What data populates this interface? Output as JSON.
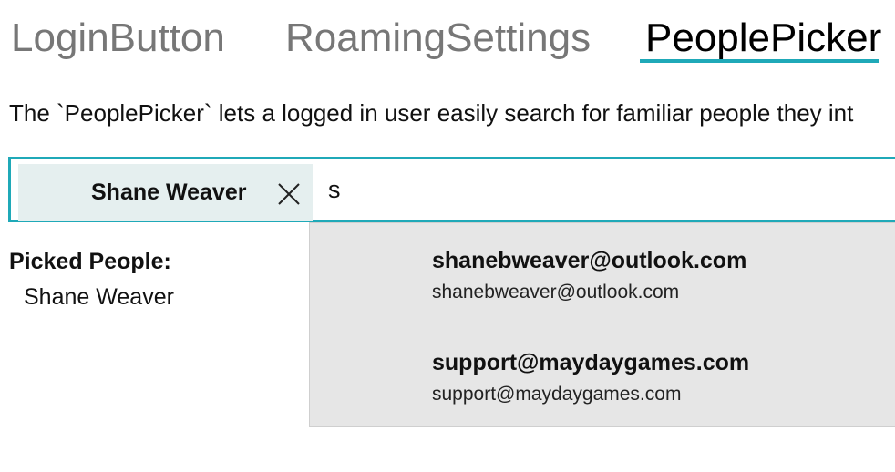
{
  "pivot": {
    "tabs": [
      {
        "label": "LoginButton"
      },
      {
        "label": "RoamingSettings"
      },
      {
        "label": "PeoplePicker"
      }
    ],
    "selected_index": 2,
    "accent_color": "#1fa9b8"
  },
  "description": "The `PeoplePicker` lets a logged in user easily search for familiar people they int",
  "picker": {
    "token": {
      "name": "Shane Weaver",
      "close_icon": "close-icon"
    },
    "query": "s"
  },
  "picked": {
    "label": "Picked People:",
    "items": [
      "Shane Weaver"
    ]
  },
  "suggestions": [
    {
      "title": "shanebweaver@outlook.com",
      "subtitle": "shanebweaver@outlook.com"
    },
    {
      "title": "support@maydaygames.com",
      "subtitle": "support@maydaygames.com"
    }
  ]
}
